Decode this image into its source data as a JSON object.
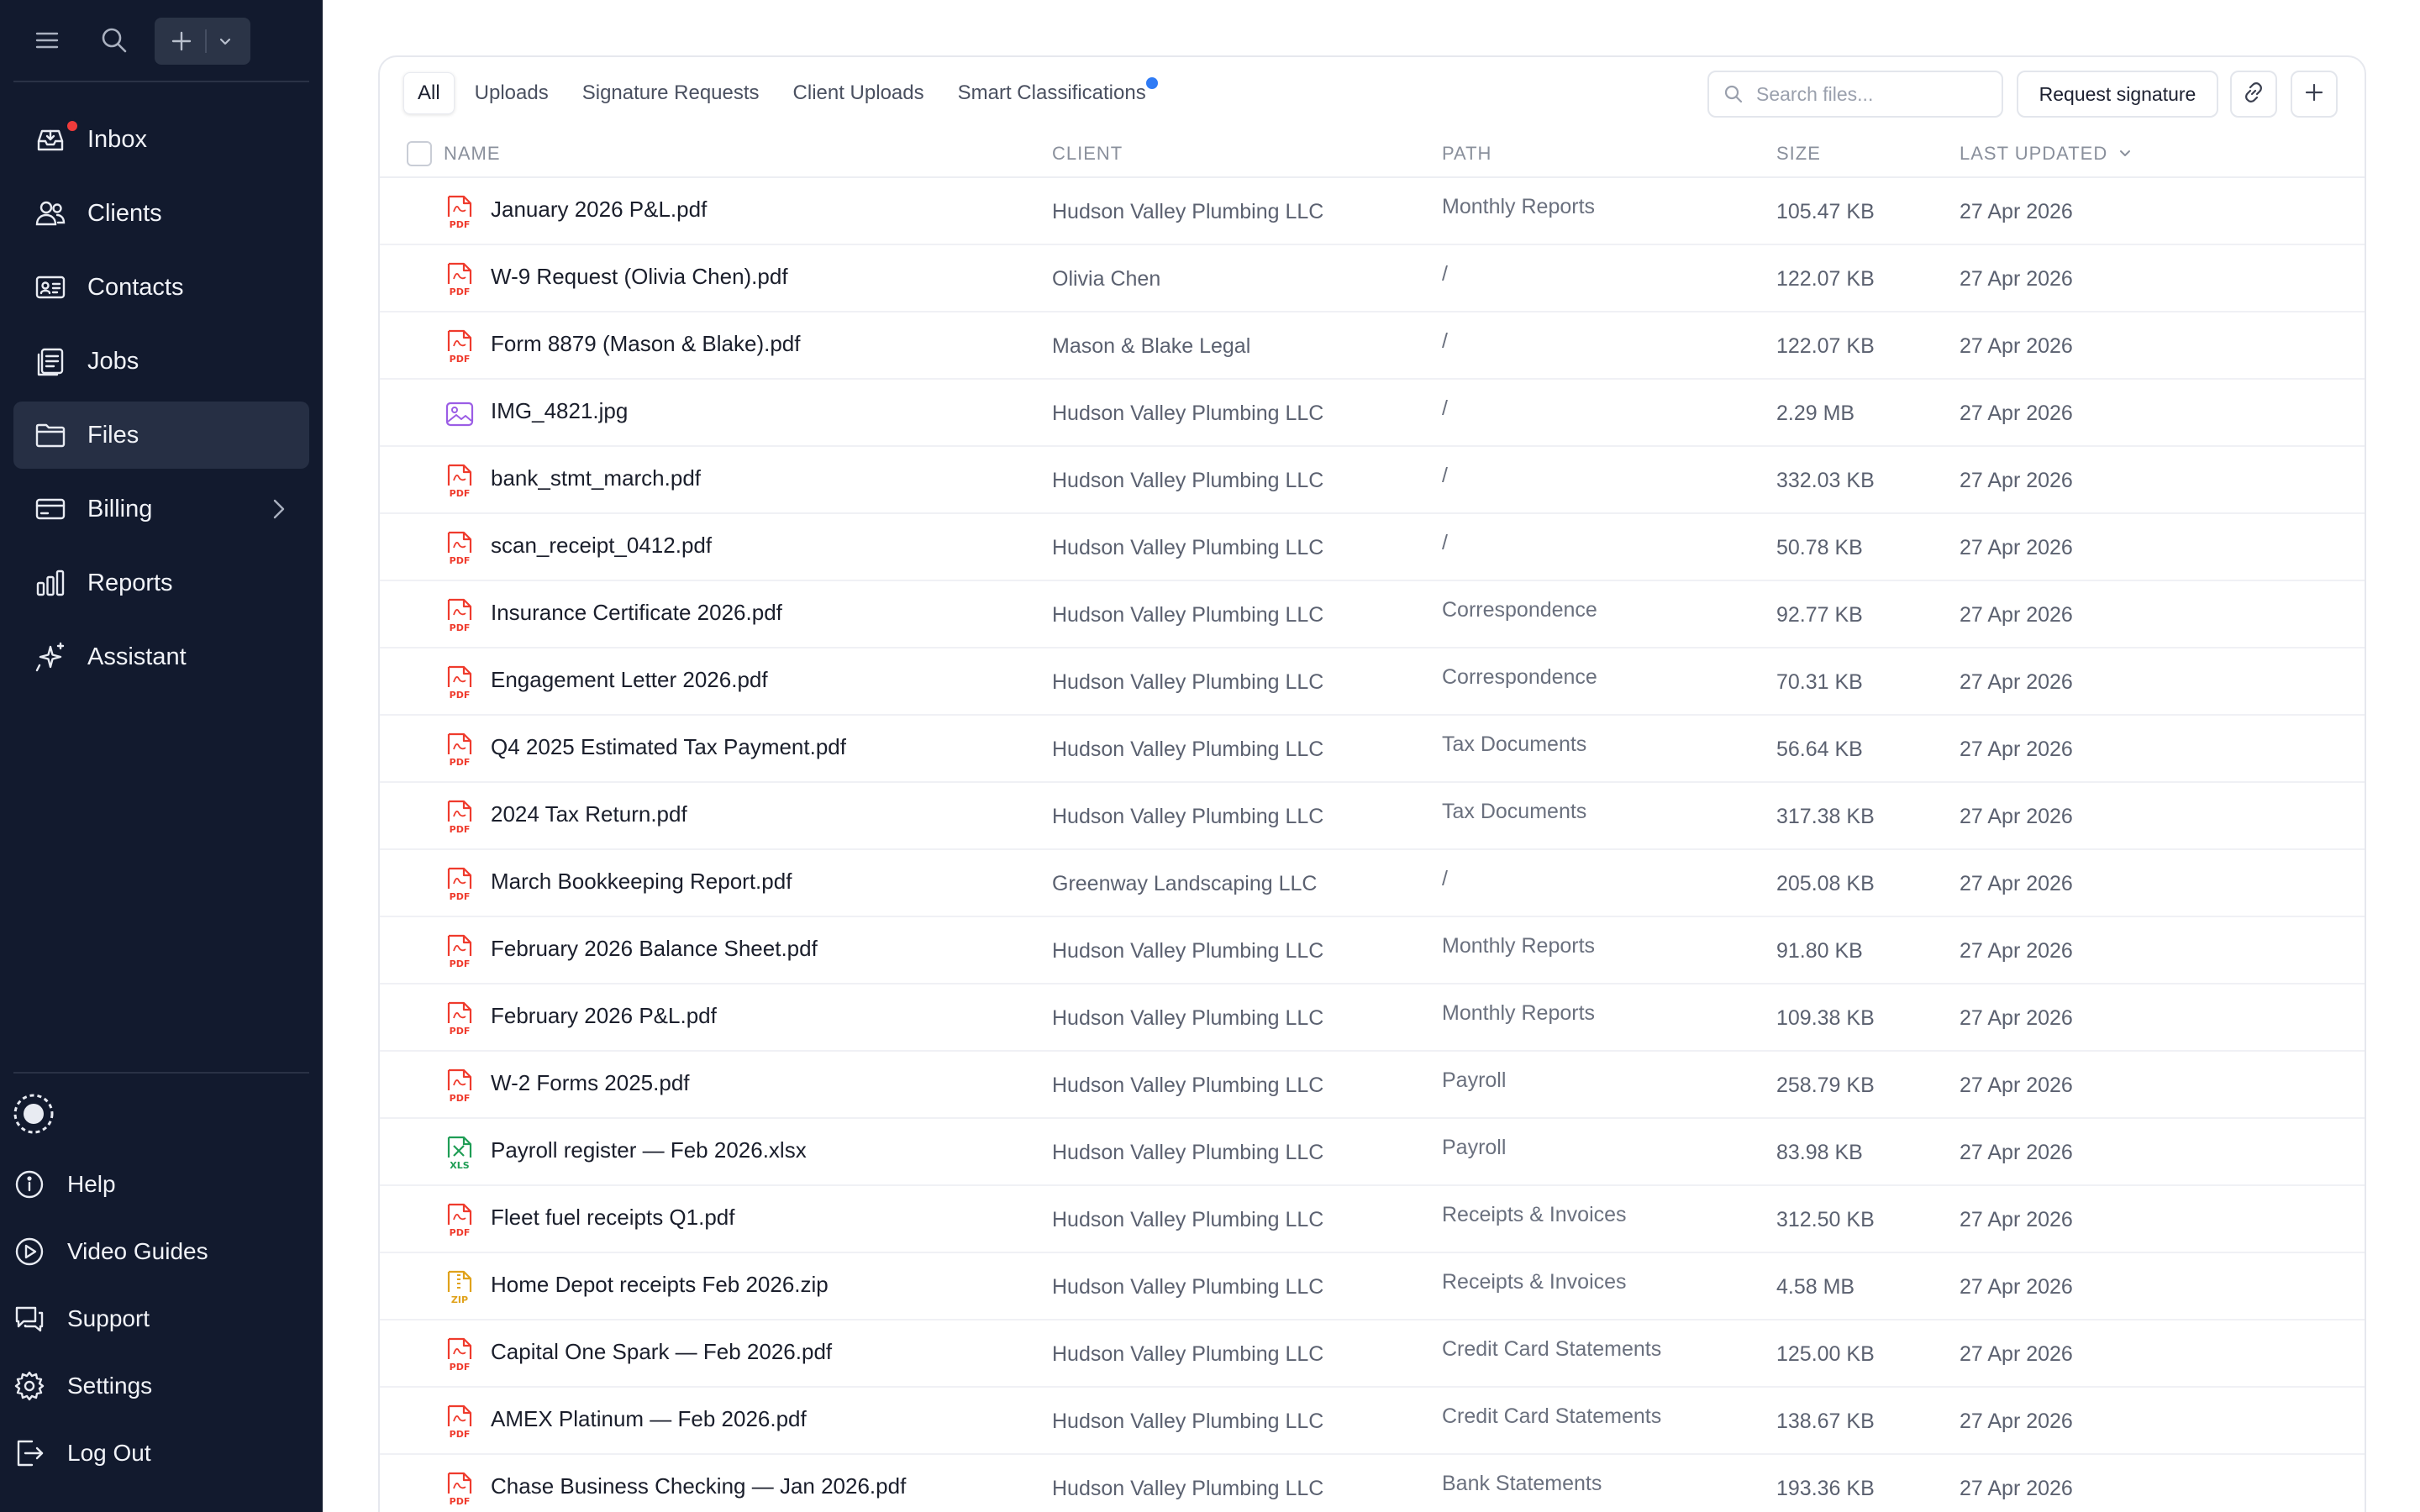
{
  "sidebar": {
    "nav": [
      {
        "label": "Inbox",
        "icon": "inbox-icon",
        "notification": true
      },
      {
        "label": "Clients",
        "icon": "users-icon"
      },
      {
        "label": "Contacts",
        "icon": "contact-card-icon"
      },
      {
        "label": "Jobs",
        "icon": "clipboard-icon"
      },
      {
        "label": "Files",
        "icon": "folder-icon",
        "active": true
      },
      {
        "label": "Billing",
        "icon": "credit-card-icon",
        "has_submenu": true
      },
      {
        "label": "Reports",
        "icon": "bar-chart-icon"
      },
      {
        "label": "Assistant",
        "icon": "sparkles-icon"
      }
    ],
    "bottom": [
      {
        "label": "Help",
        "icon": "info-icon"
      },
      {
        "label": "Video Guides",
        "icon": "play-circle-icon"
      },
      {
        "label": "Support",
        "icon": "chat-icon"
      },
      {
        "label": "Settings",
        "icon": "gear-icon"
      },
      {
        "label": "Log Out",
        "icon": "logout-icon"
      }
    ]
  },
  "tabs": [
    {
      "label": "All",
      "active": true
    },
    {
      "label": "Uploads"
    },
    {
      "label": "Signature Requests"
    },
    {
      "label": "Client Uploads"
    },
    {
      "label": "Smart Classifications",
      "dot": true
    }
  ],
  "search": {
    "placeholder": "Search files..."
  },
  "actions": {
    "request_signature": "Request signature"
  },
  "columns": {
    "name": "NAME",
    "client": "CLIENT",
    "path": "PATH",
    "size": "SIZE",
    "updated": "LAST UPDATED"
  },
  "colors": {
    "sidebar_bg": "#121a2e",
    "pdf": "#ef3b2d",
    "image": "#9b5de5",
    "xls": "#1f9d55",
    "zip": "#e0a21b",
    "accent_dot": "#2f7bf5"
  },
  "files": [
    {
      "name": "January 2026 P&L.pdf",
      "type": "pdf",
      "client": "Hudson Valley Plumbing LLC",
      "path": "Monthly Reports",
      "size": "105.47 KB",
      "updated": "27 Apr 2026"
    },
    {
      "name": "W-9 Request (Olivia Chen).pdf",
      "type": "pdf",
      "client": "Olivia Chen",
      "path": "/",
      "size": "122.07 KB",
      "updated": "27 Apr 2026"
    },
    {
      "name": "Form 8879 (Mason & Blake).pdf",
      "type": "pdf",
      "client": "Mason & Blake Legal",
      "path": "/",
      "size": "122.07 KB",
      "updated": "27 Apr 2026"
    },
    {
      "name": "IMG_4821.jpg",
      "type": "image",
      "client": "Hudson Valley Plumbing LLC",
      "path": "/",
      "size": "2.29 MB",
      "updated": "27 Apr 2026"
    },
    {
      "name": "bank_stmt_march.pdf",
      "type": "pdf",
      "client": "Hudson Valley Plumbing LLC",
      "path": "/",
      "size": "332.03 KB",
      "updated": "27 Apr 2026"
    },
    {
      "name": "scan_receipt_0412.pdf",
      "type": "pdf",
      "client": "Hudson Valley Plumbing LLC",
      "path": "/",
      "size": "50.78 KB",
      "updated": "27 Apr 2026"
    },
    {
      "name": "Insurance Certificate 2026.pdf",
      "type": "pdf",
      "client": "Hudson Valley Plumbing LLC",
      "path": "Correspondence",
      "size": "92.77 KB",
      "updated": "27 Apr 2026"
    },
    {
      "name": "Engagement Letter 2026.pdf",
      "type": "pdf",
      "client": "Hudson Valley Plumbing LLC",
      "path": "Correspondence",
      "size": "70.31 KB",
      "updated": "27 Apr 2026"
    },
    {
      "name": "Q4 2025 Estimated Tax Payment.pdf",
      "type": "pdf",
      "client": "Hudson Valley Plumbing LLC",
      "path": "Tax Documents",
      "size": "56.64 KB",
      "updated": "27 Apr 2026"
    },
    {
      "name": "2024 Tax Return.pdf",
      "type": "pdf",
      "client": "Hudson Valley Plumbing LLC",
      "path": "Tax Documents",
      "size": "317.38 KB",
      "updated": "27 Apr 2026"
    },
    {
      "name": "March Bookkeeping Report.pdf",
      "type": "pdf",
      "client": "Greenway Landscaping LLC",
      "path": "/",
      "size": "205.08 KB",
      "updated": "27 Apr 2026"
    },
    {
      "name": "February 2026 Balance Sheet.pdf",
      "type": "pdf",
      "client": "Hudson Valley Plumbing LLC",
      "path": "Monthly Reports",
      "size": "91.80 KB",
      "updated": "27 Apr 2026"
    },
    {
      "name": "February 2026 P&L.pdf",
      "type": "pdf",
      "client": "Hudson Valley Plumbing LLC",
      "path": "Monthly Reports",
      "size": "109.38 KB",
      "updated": "27 Apr 2026"
    },
    {
      "name": "W-2 Forms 2025.pdf",
      "type": "pdf",
      "client": "Hudson Valley Plumbing LLC",
      "path": "Payroll",
      "size": "258.79 KB",
      "updated": "27 Apr 2026"
    },
    {
      "name": "Payroll register — Feb 2026.xlsx",
      "type": "xls",
      "client": "Hudson Valley Plumbing LLC",
      "path": "Payroll",
      "size": "83.98 KB",
      "updated": "27 Apr 2026"
    },
    {
      "name": "Fleet fuel receipts Q1.pdf",
      "type": "pdf",
      "client": "Hudson Valley Plumbing LLC",
      "path": "Receipts & Invoices",
      "size": "312.50 KB",
      "updated": "27 Apr 2026"
    },
    {
      "name": "Home Depot receipts Feb 2026.zip",
      "type": "zip",
      "client": "Hudson Valley Plumbing LLC",
      "path": "Receipts & Invoices",
      "size": "4.58 MB",
      "updated": "27 Apr 2026"
    },
    {
      "name": "Capital One Spark — Feb 2026.pdf",
      "type": "pdf",
      "client": "Hudson Valley Plumbing LLC",
      "path": "Credit Card Statements",
      "size": "125.00 KB",
      "updated": "27 Apr 2026"
    },
    {
      "name": "AMEX Platinum — Feb 2026.pdf",
      "type": "pdf",
      "client": "Hudson Valley Plumbing LLC",
      "path": "Credit Card Statements",
      "size": "138.67 KB",
      "updated": "27 Apr 2026"
    },
    {
      "name": "Chase Business Checking — Jan 2026.pdf",
      "type": "pdf",
      "client": "Hudson Valley Plumbing LLC",
      "path": "Bank Statements",
      "size": "193.36 KB",
      "updated": "27 Apr 2026"
    }
  ]
}
